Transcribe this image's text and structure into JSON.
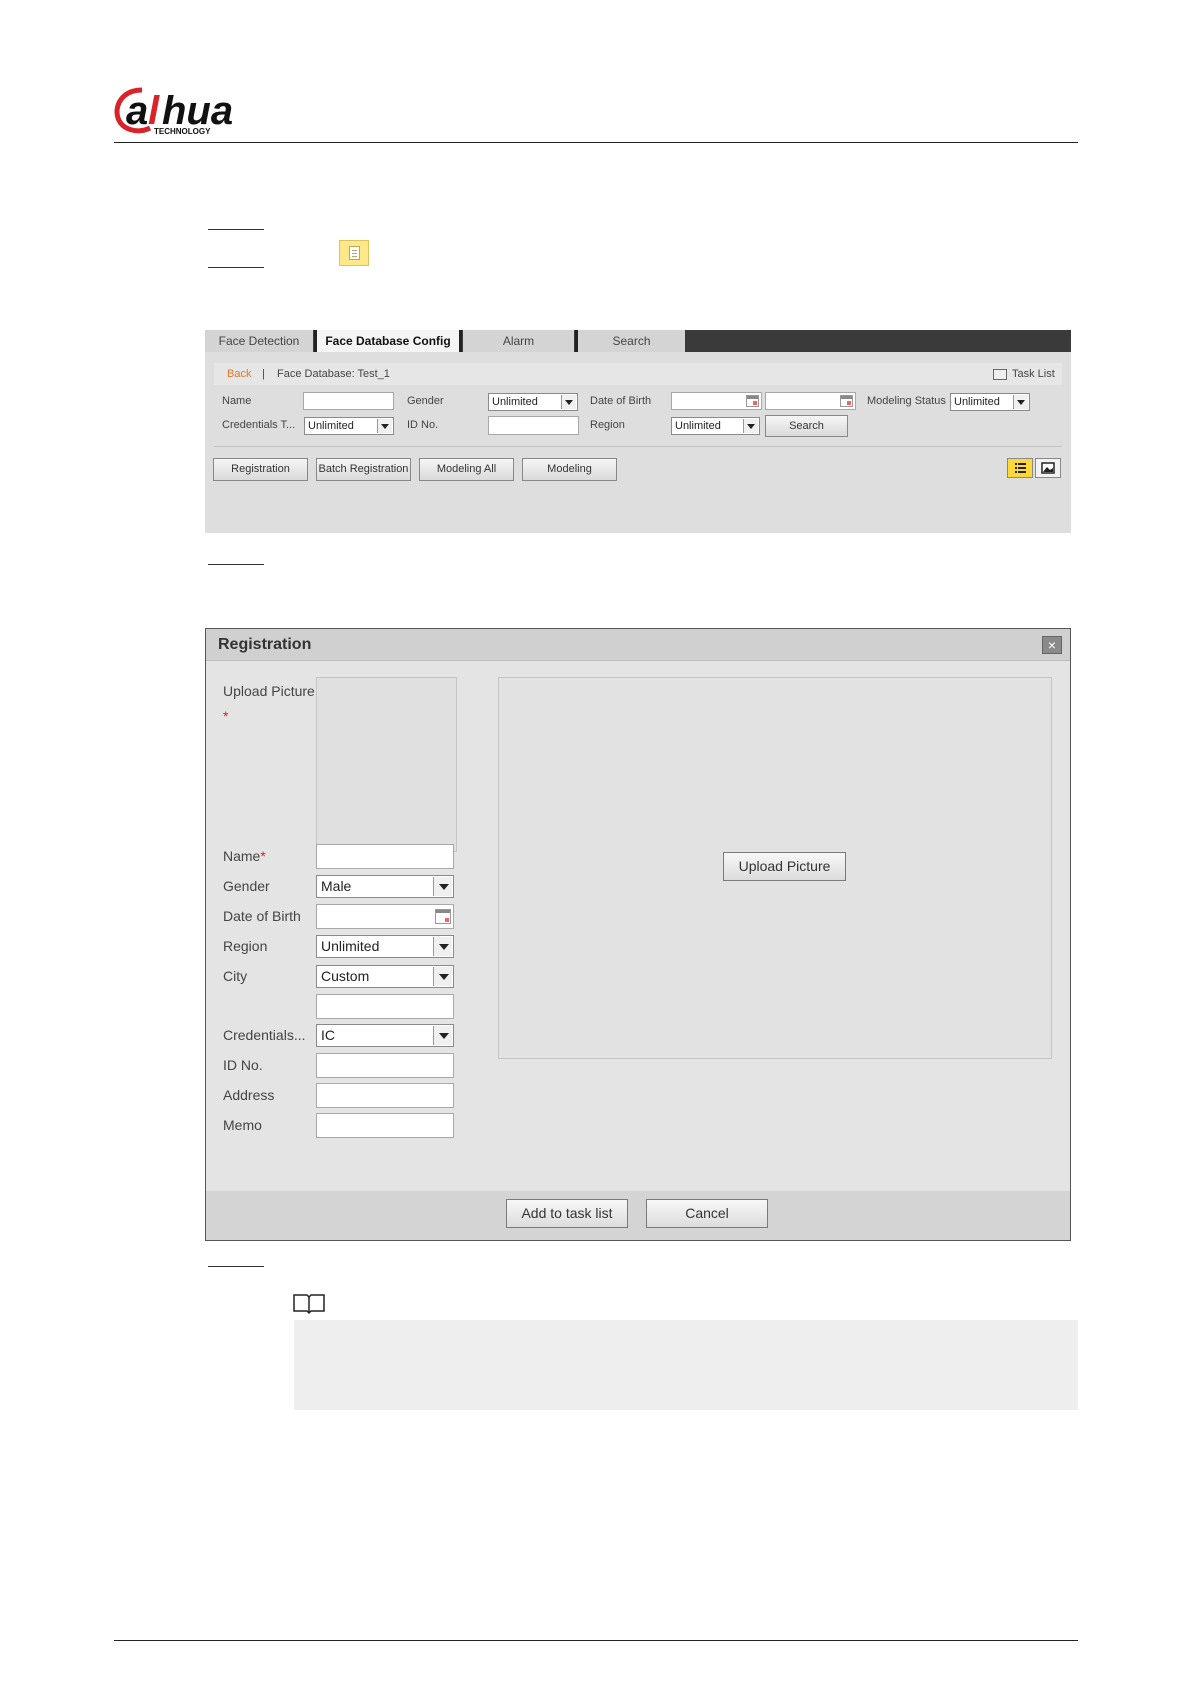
{
  "header": {
    "logo_text": "alhua",
    "logo_sub": "TECHNOLOGY"
  },
  "screen1": {
    "tabs": [
      "Face Detection",
      "Face Database Config",
      "Alarm",
      "Search"
    ],
    "back": "Back",
    "divider": "|",
    "db_label": "Face Database: Test_1",
    "task_list": "Task List",
    "labels": {
      "name": "Name",
      "gender": "Gender",
      "dob": "Date of Birth",
      "modeling_status": "Modeling Status",
      "cred_type": "Credentials T...",
      "id_no": "ID No.",
      "region": "Region"
    },
    "values": {
      "gender": "Unlimited",
      "modeling_status": "Unlimited",
      "cred_type": "Unlimited",
      "region": "Unlimited"
    },
    "search_btn": "Search",
    "buttons": [
      "Registration",
      "Batch Registration",
      "Modeling All",
      "Modeling"
    ],
    "view_list_icon": "list-view-icon",
    "view_image_icon": "image-view-icon"
  },
  "screen2": {
    "title": "Registration",
    "close": "×",
    "upload_label": "Upload Picture",
    "required_mark": "*",
    "fields": {
      "name": "Name",
      "gender": "Gender",
      "dob": "Date of Birth",
      "region": "Region",
      "city": "City",
      "credentials": "Credentials...",
      "id_no": "ID No.",
      "address": "Address",
      "memo": "Memo"
    },
    "values": {
      "gender": "Male",
      "region": "Unlimited",
      "city": "Custom",
      "credentials": "IC"
    },
    "upload_btn": "Upload Picture",
    "add_btn": "Add to task list",
    "cancel_btn": "Cancel"
  },
  "note_icon": "book-icon"
}
